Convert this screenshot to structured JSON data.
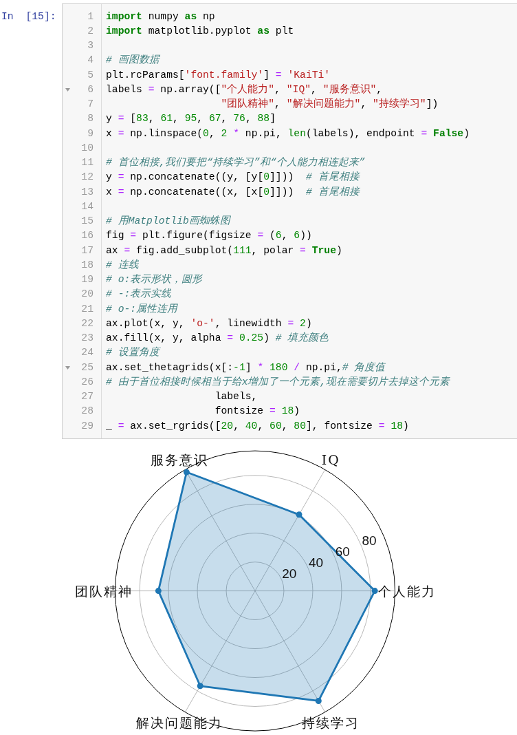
{
  "prompt": "In [15]:",
  "code_cell": {
    "lines": [
      {
        "number": "1",
        "foldable": false,
        "tokens": [
          {
            "kind": "keyword",
            "text": "import"
          },
          {
            "kind": "plain",
            "text": " numpy "
          },
          {
            "kind": "keyword",
            "text": "as"
          },
          {
            "kind": "plain",
            "text": " np"
          }
        ]
      },
      {
        "number": "2",
        "foldable": false,
        "tokens": [
          {
            "kind": "keyword",
            "text": "import"
          },
          {
            "kind": "plain",
            "text": " matplotlib.pyplot "
          },
          {
            "kind": "keyword",
            "text": "as"
          },
          {
            "kind": "plain",
            "text": " plt"
          }
        ]
      },
      {
        "number": "3",
        "foldable": false
      },
      {
        "number": "4",
        "foldable": false,
        "tokens": [
          {
            "kind": "comment",
            "text": "# 画图数据"
          }
        ]
      },
      {
        "number": "5",
        "foldable": false,
        "tokens": [
          {
            "kind": "plain",
            "text": "plt.rcParams["
          },
          {
            "kind": "string",
            "text": "'font.family'"
          },
          {
            "kind": "plain",
            "text": "] "
          },
          {
            "kind": "operator",
            "text": "= "
          },
          {
            "kind": "string",
            "text": "'KaiTi'"
          }
        ]
      },
      {
        "number": "6",
        "foldable": true,
        "tokens": [
          {
            "kind": "plain",
            "text": "labels "
          },
          {
            "kind": "operator",
            "text": "="
          },
          {
            "kind": "plain",
            "text": " np.array(["
          },
          {
            "kind": "string",
            "text": "\"个人能力\""
          },
          {
            "kind": "plain",
            "text": ", "
          },
          {
            "kind": "string",
            "text": "\"IQ\""
          },
          {
            "kind": "plain",
            "text": ", "
          },
          {
            "kind": "string",
            "text": "\"服务意识\""
          },
          {
            "kind": "plain",
            "text": ","
          }
        ]
      },
      {
        "number": "7",
        "foldable": false,
        "tokens": [
          {
            "kind": "string",
            "text": "                   \"团队精神\""
          },
          {
            "kind": "plain",
            "text": ", "
          },
          {
            "kind": "string",
            "text": "\"解决问题能力\""
          },
          {
            "kind": "plain",
            "text": ", "
          },
          {
            "kind": "string",
            "text": "\"持续学习\""
          },
          {
            "kind": "plain",
            "text": "])"
          }
        ]
      },
      {
        "number": "8",
        "foldable": false,
        "tokens": [
          {
            "kind": "plain",
            "text": "y "
          },
          {
            "kind": "operator",
            "text": "="
          },
          {
            "kind": "plain",
            "text": " ["
          },
          {
            "kind": "number",
            "text": "83"
          },
          {
            "kind": "plain",
            "text": ", "
          },
          {
            "kind": "number",
            "text": "61"
          },
          {
            "kind": "plain",
            "text": ", "
          },
          {
            "kind": "number",
            "text": "95"
          },
          {
            "kind": "plain",
            "text": ", "
          },
          {
            "kind": "number",
            "text": "67"
          },
          {
            "kind": "plain",
            "text": ", "
          },
          {
            "kind": "number",
            "text": "76"
          },
          {
            "kind": "plain",
            "text": ", "
          },
          {
            "kind": "number",
            "text": "88"
          },
          {
            "kind": "plain",
            "text": "]"
          }
        ]
      },
      {
        "number": "9",
        "foldable": false,
        "tokens": [
          {
            "kind": "plain",
            "text": "x "
          },
          {
            "kind": "operator",
            "text": "="
          },
          {
            "kind": "plain",
            "text": " np.linspace("
          },
          {
            "kind": "number",
            "text": "0"
          },
          {
            "kind": "plain",
            "text": ", "
          },
          {
            "kind": "number",
            "text": "2"
          },
          {
            "kind": "operator",
            "text": " *"
          },
          {
            "kind": "plain",
            "text": " np.pi, "
          },
          {
            "kind": "builtin",
            "text": "len"
          },
          {
            "kind": "plain",
            "text": "(labels), endpoint "
          },
          {
            "kind": "operator",
            "text": "= "
          },
          {
            "kind": "keyword",
            "text": "False"
          },
          {
            "kind": "plain",
            "text": ")"
          }
        ]
      },
      {
        "number": "10",
        "foldable": false
      },
      {
        "number": "11",
        "foldable": false,
        "tokens": [
          {
            "kind": "comment",
            "text": "# 首位相接,我们要把“持续学习”和“个人能力相连起来”"
          }
        ]
      },
      {
        "number": "12",
        "foldable": false,
        "tokens": [
          {
            "kind": "plain",
            "text": "y "
          },
          {
            "kind": "operator",
            "text": "="
          },
          {
            "kind": "plain",
            "text": " np.concatenate((y, [y["
          },
          {
            "kind": "number",
            "text": "0"
          },
          {
            "kind": "plain",
            "text": "]]))  "
          },
          {
            "kind": "comment",
            "text": "# 首尾相接"
          }
        ]
      },
      {
        "number": "13",
        "foldable": false,
        "tokens": [
          {
            "kind": "plain",
            "text": "x "
          },
          {
            "kind": "operator",
            "text": "="
          },
          {
            "kind": "plain",
            "text": " np.concatenate((x, [x["
          },
          {
            "kind": "number",
            "text": "0"
          },
          {
            "kind": "plain",
            "text": "]]))  "
          },
          {
            "kind": "comment",
            "text": "# 首尾相接"
          }
        ]
      },
      {
        "number": "14",
        "foldable": false
      },
      {
        "number": "15",
        "foldable": false,
        "tokens": [
          {
            "kind": "comment",
            "text": "# 用Matplotlib画蜘蛛图"
          }
        ]
      },
      {
        "number": "16",
        "foldable": false,
        "tokens": [
          {
            "kind": "plain",
            "text": "fig "
          },
          {
            "kind": "operator",
            "text": "="
          },
          {
            "kind": "plain",
            "text": " plt.figure(figsize "
          },
          {
            "kind": "operator",
            "text": "="
          },
          {
            "kind": "plain",
            "text": " ("
          },
          {
            "kind": "number",
            "text": "6"
          },
          {
            "kind": "plain",
            "text": ", "
          },
          {
            "kind": "number",
            "text": "6"
          },
          {
            "kind": "plain",
            "text": "))"
          }
        ]
      },
      {
        "number": "17",
        "foldable": false,
        "tokens": [
          {
            "kind": "plain",
            "text": "ax "
          },
          {
            "kind": "operator",
            "text": "="
          },
          {
            "kind": "plain",
            "text": " fig.add_subplot("
          },
          {
            "kind": "number",
            "text": "111"
          },
          {
            "kind": "plain",
            "text": ", polar "
          },
          {
            "kind": "operator",
            "text": "= "
          },
          {
            "kind": "keyword",
            "text": "True"
          },
          {
            "kind": "plain",
            "text": ")"
          }
        ]
      },
      {
        "number": "18",
        "foldable": false,
        "tokens": [
          {
            "kind": "comment",
            "text": "# 连线"
          }
        ]
      },
      {
        "number": "19",
        "foldable": false,
        "tokens": [
          {
            "kind": "comment",
            "text": "# o:表示形状，圆形"
          }
        ]
      },
      {
        "number": "20",
        "foldable": false,
        "tokens": [
          {
            "kind": "comment",
            "text": "# -:表示实线"
          }
        ]
      },
      {
        "number": "21",
        "foldable": false,
        "tokens": [
          {
            "kind": "comment",
            "text": "# o-:属性连用"
          }
        ]
      },
      {
        "number": "22",
        "foldable": false,
        "tokens": [
          {
            "kind": "plain",
            "text": "ax.plot(x, y, "
          },
          {
            "kind": "string",
            "text": "'o-'"
          },
          {
            "kind": "plain",
            "text": ", linewidth "
          },
          {
            "kind": "operator",
            "text": "= "
          },
          {
            "kind": "number",
            "text": "2"
          },
          {
            "kind": "plain",
            "text": ")"
          }
        ]
      },
      {
        "number": "23",
        "foldable": false,
        "tokens": [
          {
            "kind": "plain",
            "text": "ax.fill(x, y, alpha "
          },
          {
            "kind": "operator",
            "text": "= "
          },
          {
            "kind": "number",
            "text": "0.25"
          },
          {
            "kind": "plain",
            "text": ") "
          },
          {
            "kind": "comment",
            "text": "# 填充颜色"
          }
        ]
      },
      {
        "number": "24",
        "foldable": false,
        "tokens": [
          {
            "kind": "comment",
            "text": "# 设置角度"
          }
        ]
      },
      {
        "number": "25",
        "foldable": true,
        "tokens": [
          {
            "kind": "plain",
            "text": "ax.set_thetagrids(x[:"
          },
          {
            "kind": "number",
            "text": "-1"
          },
          {
            "kind": "plain",
            "text": "] "
          },
          {
            "kind": "operator",
            "text": "* "
          },
          {
            "kind": "number",
            "text": "180"
          },
          {
            "kind": "operator",
            "text": " /"
          },
          {
            "kind": "plain",
            "text": " np.pi,"
          },
          {
            "kind": "comment",
            "text": "# 角度值"
          }
        ]
      },
      {
        "number": "26",
        "foldable": false,
        "tokens": [
          {
            "kind": "comment",
            "text": "# 由于首位相接时候相当于给x增加了一个元素,现在需要切片去掉这个元素"
          }
        ]
      },
      {
        "number": "27",
        "foldable": false,
        "tokens": [
          {
            "kind": "plain",
            "text": "                  labels,"
          }
        ]
      },
      {
        "number": "28",
        "foldable": false,
        "tokens": [
          {
            "kind": "plain",
            "text": "                  fontsize "
          },
          {
            "kind": "operator",
            "text": "= "
          },
          {
            "kind": "number",
            "text": "18"
          },
          {
            "kind": "plain",
            "text": ")"
          }
        ]
      },
      {
        "number": "29",
        "foldable": false,
        "tokens": [
          {
            "kind": "plain",
            "text": "_ "
          },
          {
            "kind": "operator",
            "text": "="
          },
          {
            "kind": "plain",
            "text": " ax.set_rgrids(["
          },
          {
            "kind": "number",
            "text": "20"
          },
          {
            "kind": "plain",
            "text": ", "
          },
          {
            "kind": "number",
            "text": "40"
          },
          {
            "kind": "plain",
            "text": ", "
          },
          {
            "kind": "number",
            "text": "60"
          },
          {
            "kind": "plain",
            "text": ", "
          },
          {
            "kind": "number",
            "text": "80"
          },
          {
            "kind": "plain",
            "text": "], fontsize "
          },
          {
            "kind": "operator",
            "text": "= "
          },
          {
            "kind": "number",
            "text": "18"
          },
          {
            "kind": "plain",
            "text": ")"
          }
        ]
      }
    ]
  },
  "output": {
    "radar_chart": {
      "axis_labels": [
        "个人能力",
        "IQ",
        "服务意识",
        "团队精神",
        "解决问题能力",
        "持续学习"
      ],
      "scale_labels": [
        "20",
        "40",
        "60",
        "80"
      ]
    }
  }
}
